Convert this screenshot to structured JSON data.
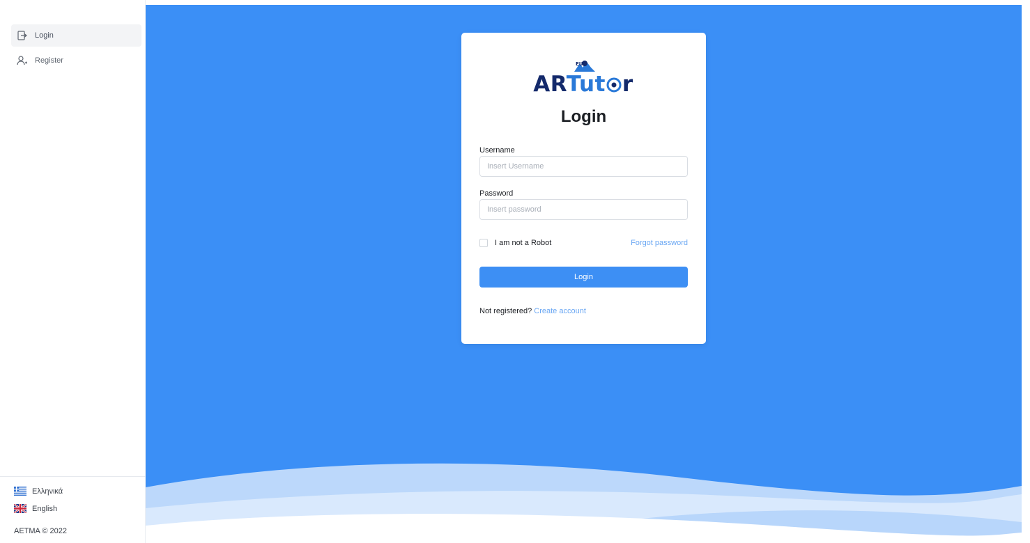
{
  "sidebar": {
    "items": [
      {
        "label": "Login",
        "icon": "login-icon"
      },
      {
        "label": "Register",
        "icon": "add-user-icon"
      }
    ],
    "languages": [
      {
        "label": "Ελληνικά",
        "icon": "greek-flag-icon"
      },
      {
        "label": "English",
        "icon": "uk-flag-icon"
      }
    ],
    "copyright": "AETMA © 2022"
  },
  "card": {
    "logo": {
      "text_part1": "AR",
      "text_part2": "Tut",
      "text_part3": "r",
      "badge": "EU"
    },
    "title": "Login",
    "username": {
      "label": "Username",
      "placeholder": "Insert Username",
      "value": ""
    },
    "password": {
      "label": "Password",
      "placeholder": "Insert password",
      "value": ""
    },
    "robot_label": "I am not a Robot",
    "forgot_label": "Forgot password",
    "login_button": "Login",
    "not_registered": "Not registered?",
    "create_account": "Create account"
  },
  "colors": {
    "background_blue": "#3b8ff6",
    "primary_button": "#3d8ff4",
    "link": "#6aa7f3",
    "logo_dark": "#142a6b",
    "logo_light": "#2a79d8"
  }
}
